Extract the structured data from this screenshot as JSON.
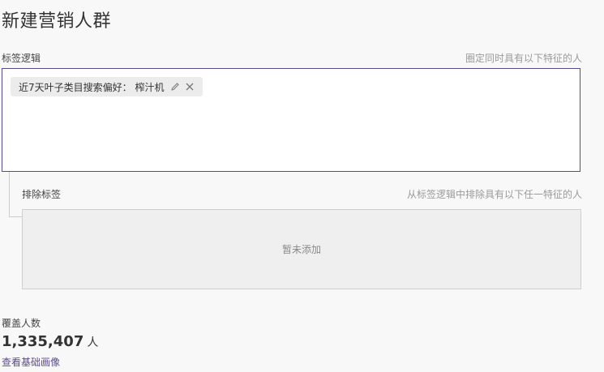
{
  "page": {
    "title": "新建营销人群"
  },
  "tag_logic": {
    "label": "标签逻辑",
    "hint": "圈定同时具有以下特征的人",
    "tags": [
      {
        "text": "近7天叶子类目搜索偏好：  榨汁机"
      }
    ]
  },
  "exclude": {
    "label": "排除标签",
    "hint": "从标签逻辑中排除具有以下任一特征的人",
    "empty_text": "暂未添加"
  },
  "coverage": {
    "label": "覆盖人数",
    "value": "1,335,407",
    "unit": "人",
    "link": "查看基础画像"
  }
}
